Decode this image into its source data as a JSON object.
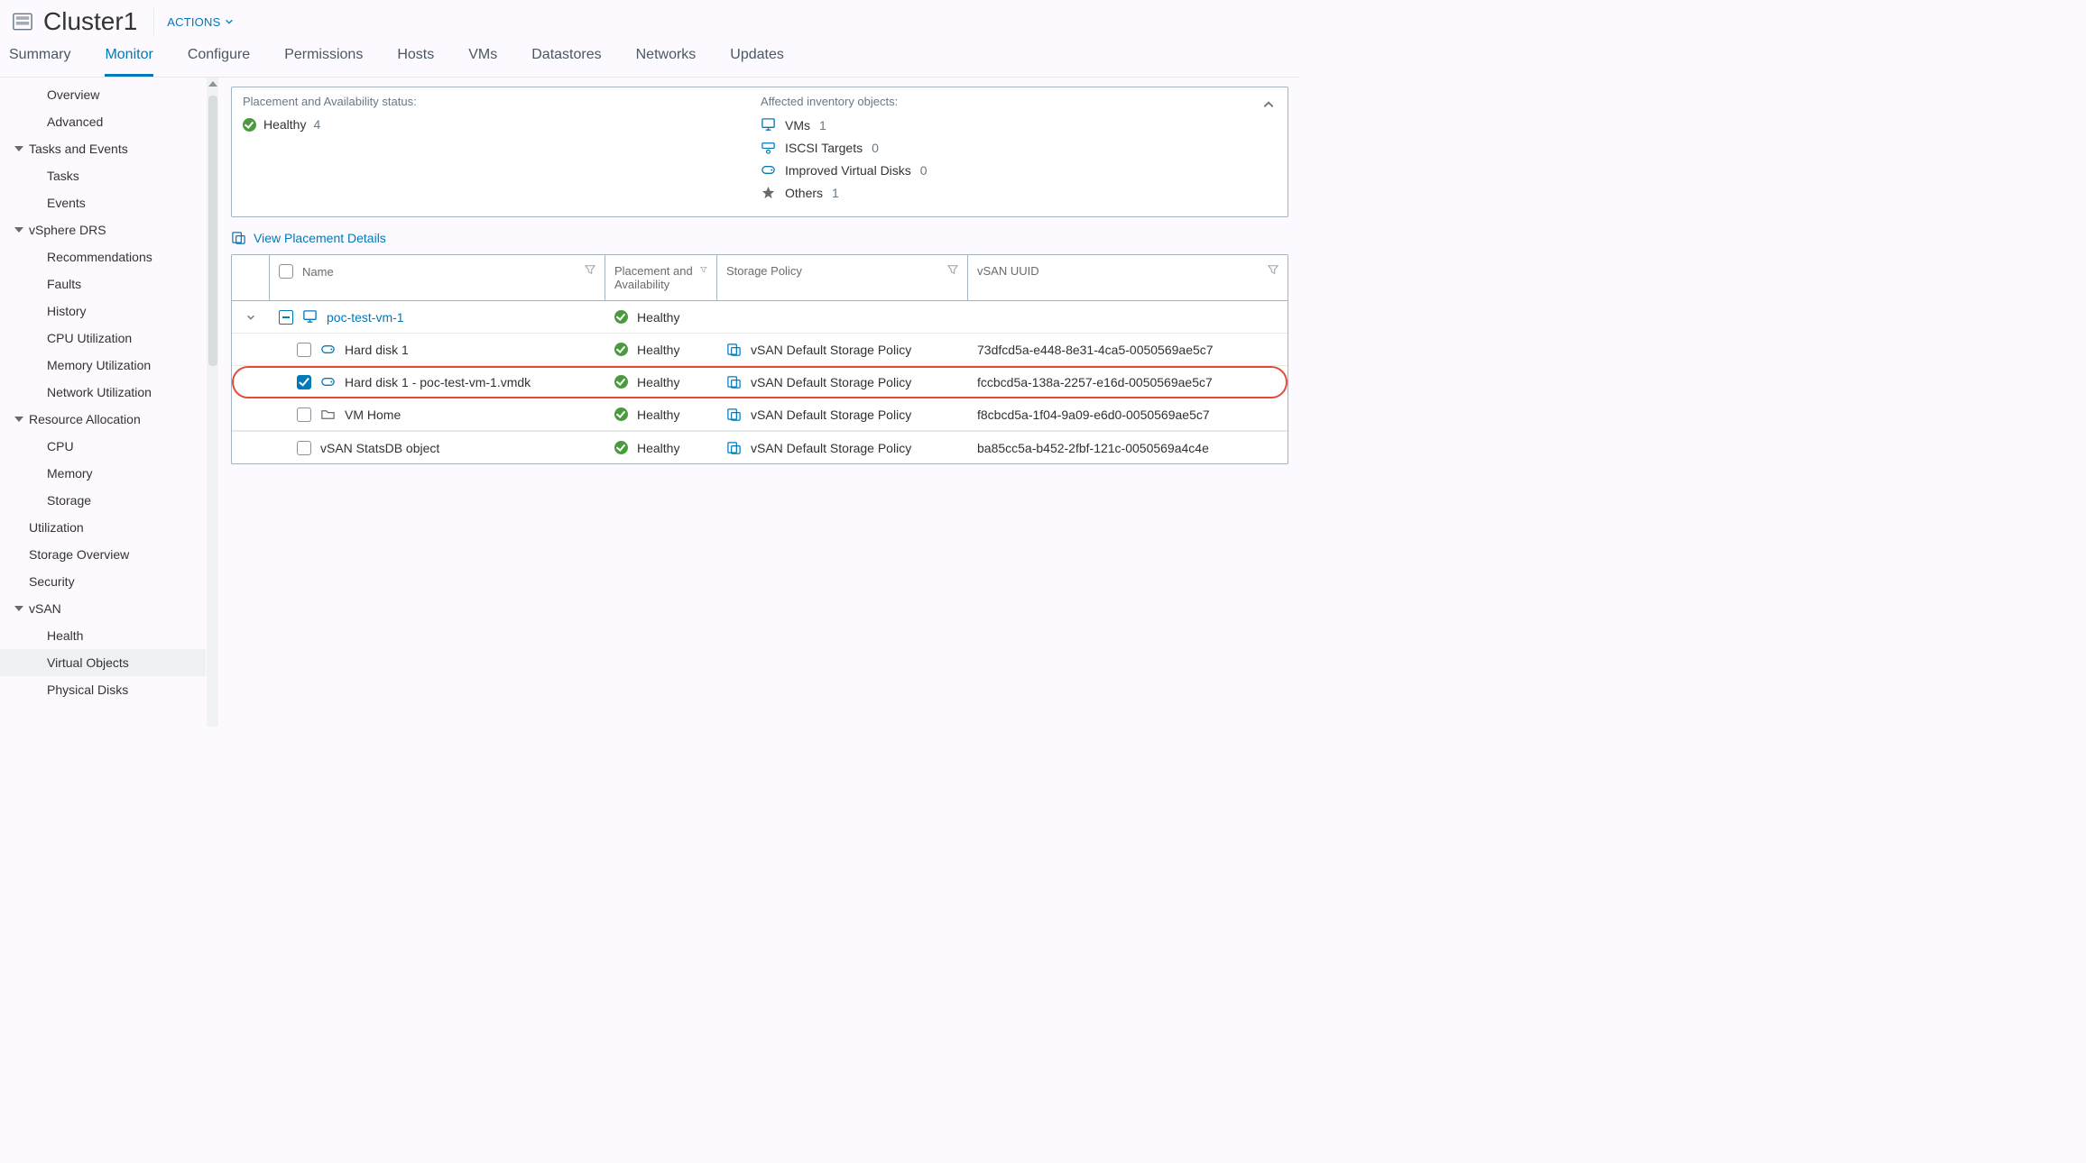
{
  "header": {
    "title": "Cluster1",
    "actions_label": "ACTIONS"
  },
  "tabs": [
    "Summary",
    "Monitor",
    "Configure",
    "Permissions",
    "Hosts",
    "VMs",
    "Datastores",
    "Networks",
    "Updates"
  ],
  "tabs_selected": "Monitor",
  "sidebar": {
    "items": [
      {
        "type": "item",
        "label": "Overview"
      },
      {
        "type": "item",
        "label": "Advanced"
      },
      {
        "type": "group",
        "label": "Tasks and Events"
      },
      {
        "type": "item",
        "label": "Tasks"
      },
      {
        "type": "item",
        "label": "Events"
      },
      {
        "type": "group",
        "label": "vSphere DRS"
      },
      {
        "type": "item",
        "label": "Recommendations"
      },
      {
        "type": "item",
        "label": "Faults"
      },
      {
        "type": "item",
        "label": "History"
      },
      {
        "type": "item",
        "label": "CPU Utilization"
      },
      {
        "type": "item",
        "label": "Memory Utilization"
      },
      {
        "type": "item",
        "label": "Network Utilization"
      },
      {
        "type": "group",
        "label": "Resource Allocation"
      },
      {
        "type": "item",
        "label": "CPU"
      },
      {
        "type": "item",
        "label": "Memory"
      },
      {
        "type": "item",
        "label": "Storage"
      },
      {
        "type": "item-top",
        "label": "Utilization"
      },
      {
        "type": "item-top",
        "label": "Storage Overview"
      },
      {
        "type": "item-top",
        "label": "Security"
      },
      {
        "type": "group",
        "label": "vSAN"
      },
      {
        "type": "item",
        "label": "Health"
      },
      {
        "type": "item",
        "label": "Virtual Objects",
        "selected": true
      },
      {
        "type": "item",
        "label": "Physical Disks"
      }
    ]
  },
  "panel": {
    "left_title": "Placement and Availability status:",
    "healthy_label": "Healthy",
    "healthy_count": "4",
    "right_title": "Affected inventory objects:",
    "objects": [
      {
        "icon": "vm",
        "label": "VMs",
        "count": "1"
      },
      {
        "icon": "iscsi",
        "label": "ISCSI Targets",
        "count": "0"
      },
      {
        "icon": "disk",
        "label": "Improved Virtual Disks",
        "count": "0"
      },
      {
        "icon": "other",
        "label": "Others",
        "count": "1"
      }
    ]
  },
  "view_details_label": "View Placement Details",
  "table": {
    "columns": {
      "name": "Name",
      "place": "Placement and Availability",
      "policy": "Storage Policy",
      "uuid": "vSAN UUID"
    },
    "rows": [
      {
        "kind": "vm",
        "name": "poc-test-vm-1",
        "health": "Healthy",
        "policy": "",
        "uuid": ""
      },
      {
        "kind": "disk",
        "name": "Hard disk 1",
        "health": "Healthy",
        "policy": "vSAN Default Storage Policy",
        "uuid": "73dfcd5a-e448-8e31-4ca5-0050569ae5c7"
      },
      {
        "kind": "disk",
        "name": "Hard disk 1 - poc-test-vm-1.vmdk",
        "health": "Healthy",
        "policy": "vSAN Default Storage Policy",
        "uuid": "fccbcd5a-138a-2257-e16d-0050569ae5c7",
        "checked": true,
        "highlight": true
      },
      {
        "kind": "home",
        "name": "VM Home",
        "health": "Healthy",
        "policy": "vSAN Default Storage Policy",
        "uuid": "f8cbcd5a-1f04-9a09-e6d0-0050569ae5c7"
      },
      {
        "kind": "obj",
        "name": "vSAN StatsDB object",
        "health": "Healthy",
        "policy": "vSAN Default Storage Policy",
        "uuid": "ba85cc5a-b452-2fbf-121c-0050569a4c4e"
      }
    ]
  }
}
